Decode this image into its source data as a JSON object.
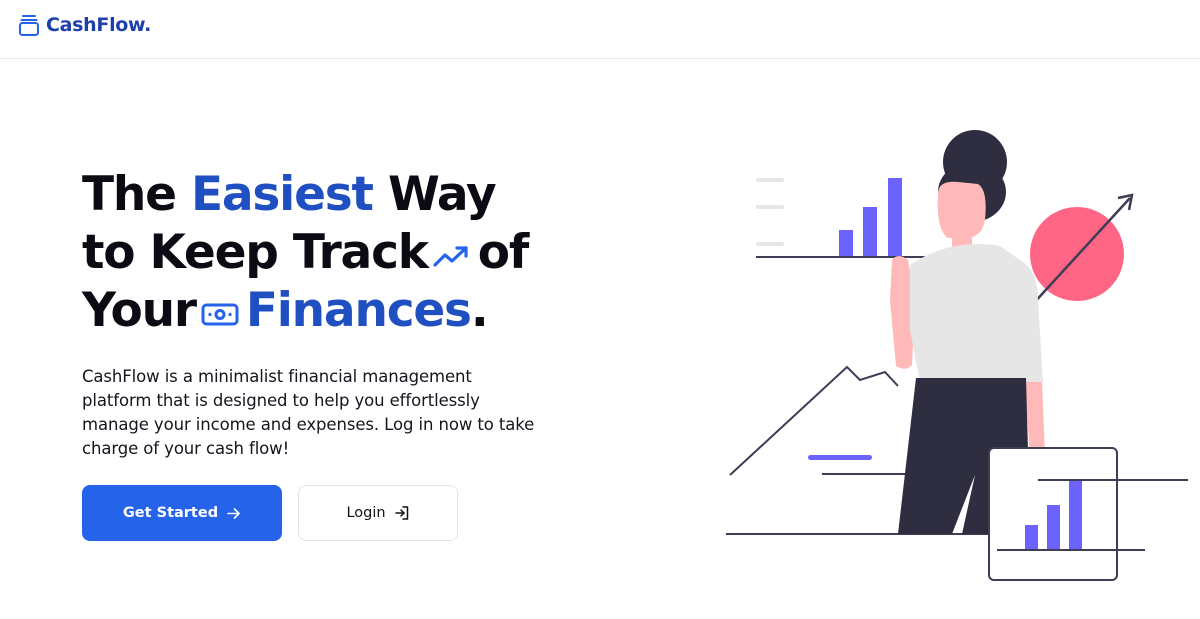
{
  "brand": {
    "name": "CashFlow.",
    "icon": "wallet-icon"
  },
  "hero": {
    "title_line1_pre": "The ",
    "title_line1_accent": "Easiest",
    "title_line1_post": " Way",
    "title_line2_pre": "to Keep Track",
    "title_line2_post": "of",
    "title_line3_pre": "Your",
    "title_line3_accent": "Finances",
    "title_line3_post": ".",
    "description": "CashFlow is a minimalist financial management platform that is designed to help you effortlessly manage your income and expenses. Log in now to take charge of your cash flow!"
  },
  "actions": {
    "primary_label": "Get Started",
    "secondary_label": "Login"
  },
  "colors": {
    "brand": "#1c3faa",
    "accent": "#1f4fc1",
    "primary_button": "#2563eb",
    "illustration_bars": "#6c63ff",
    "illustration_circle": "#ff6584"
  },
  "icons": {
    "trend": "trending-up-icon",
    "money": "banknote-icon",
    "arrow": "arrow-right-icon",
    "login": "login-icon"
  }
}
